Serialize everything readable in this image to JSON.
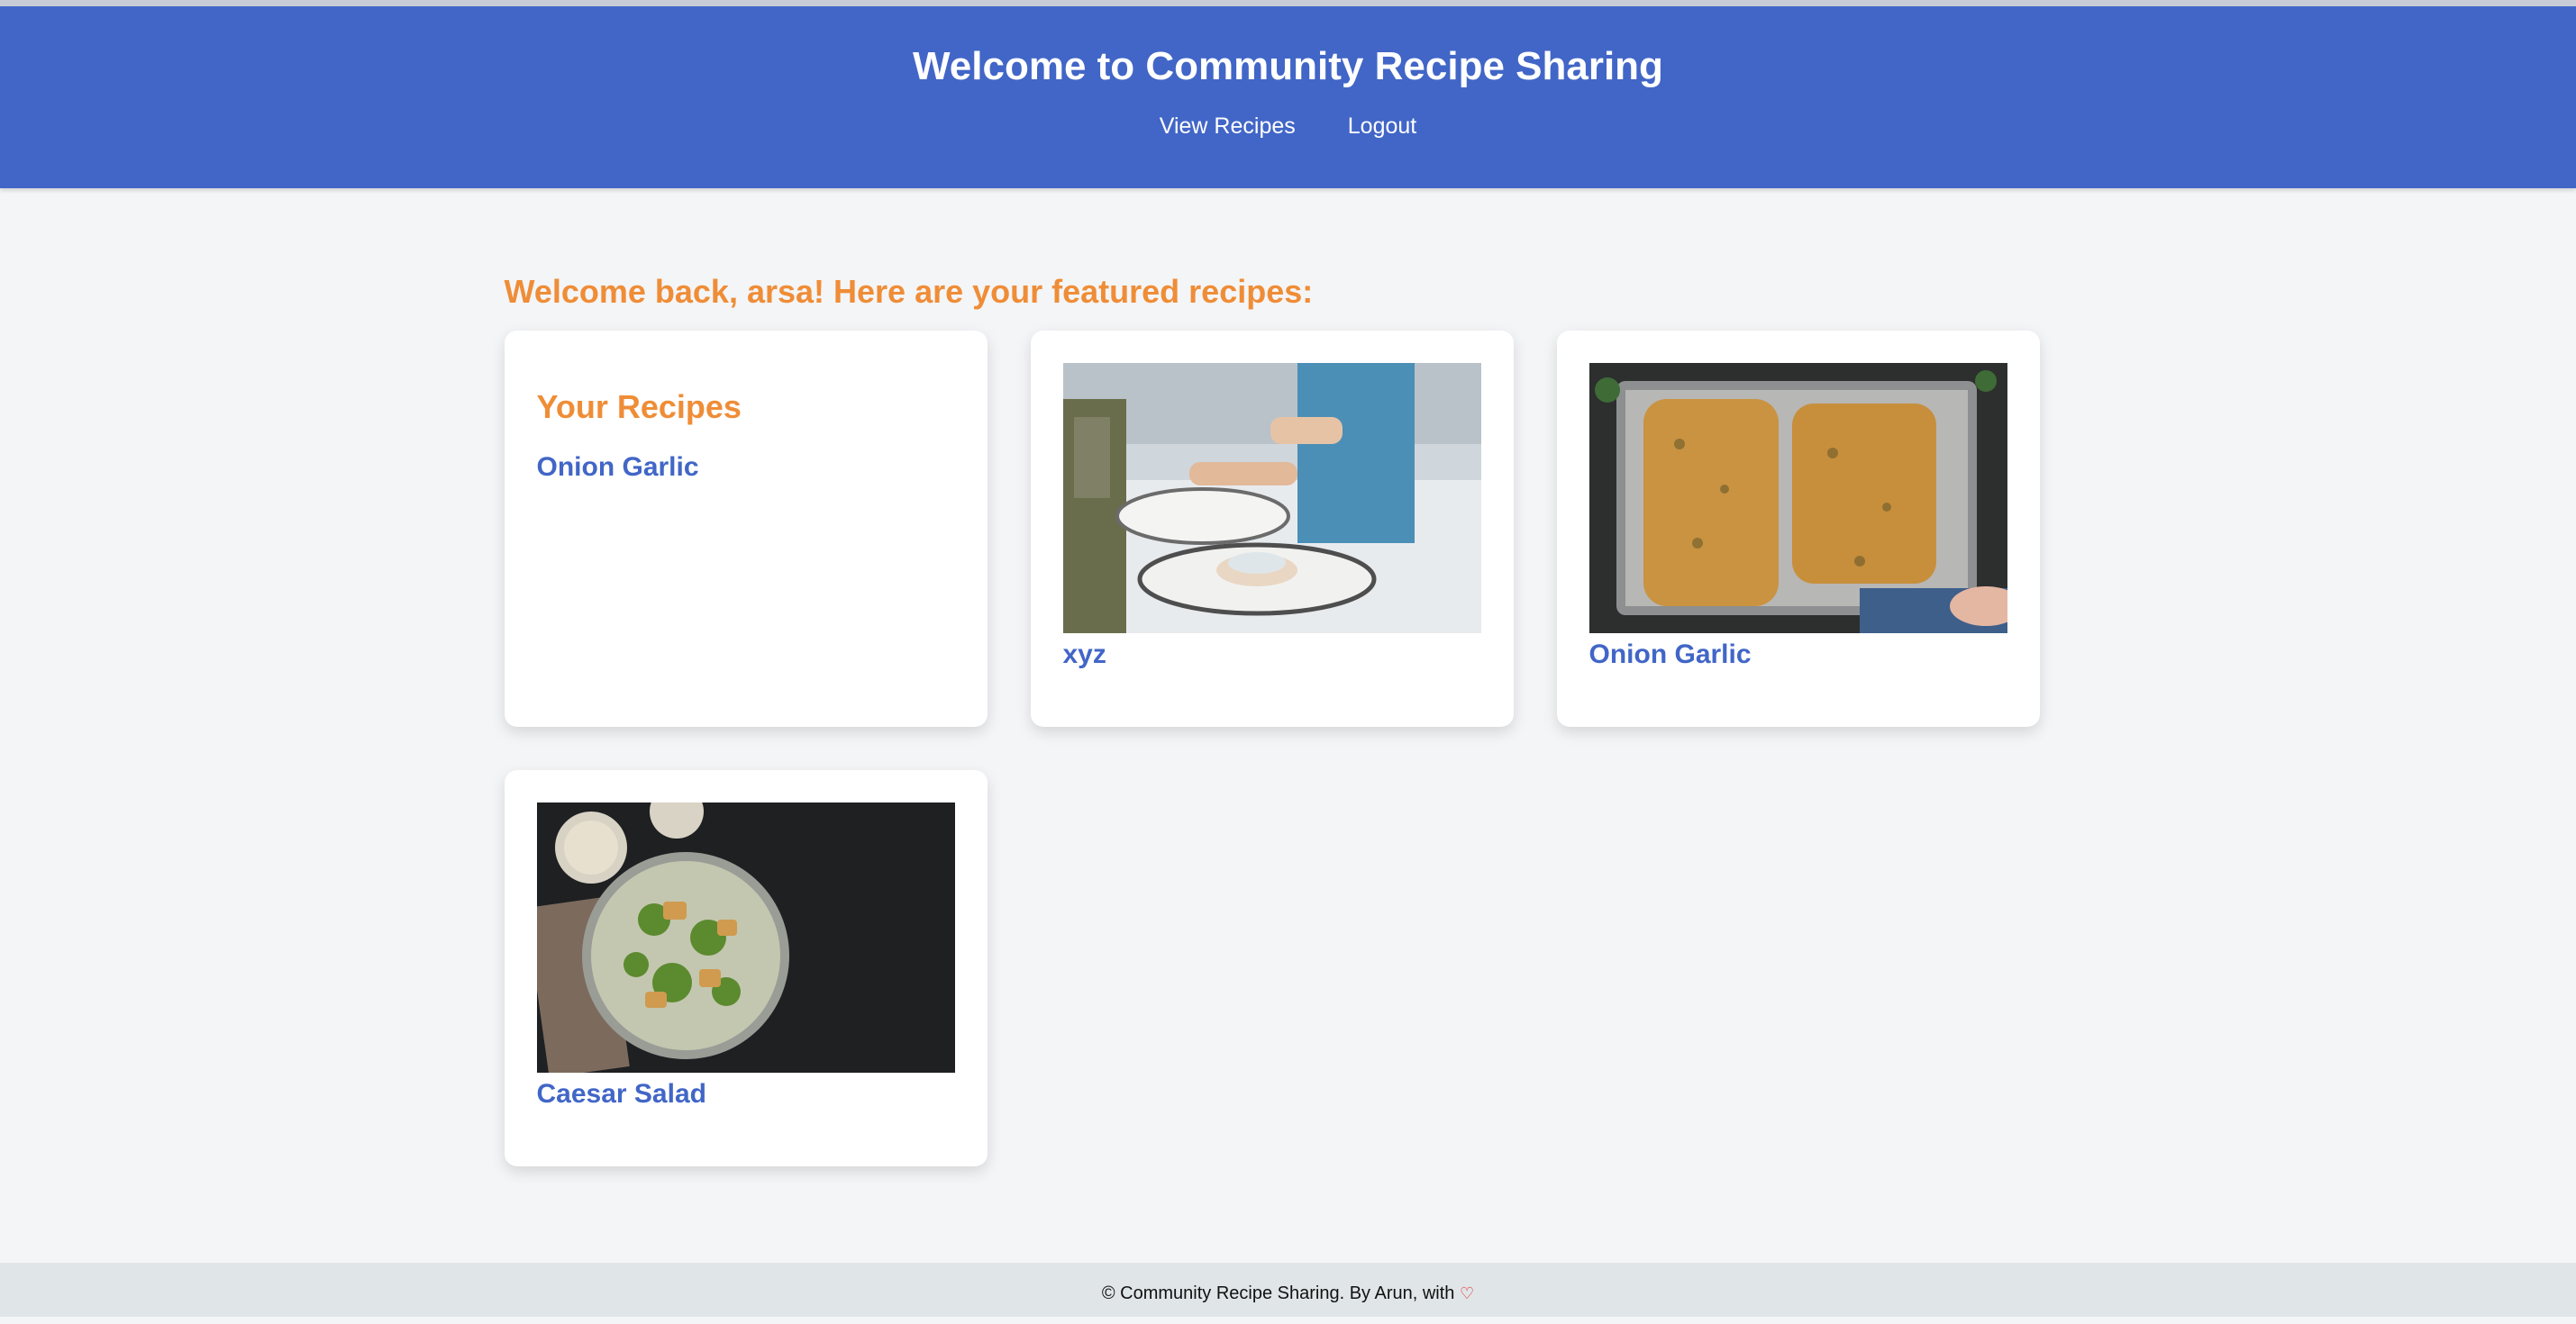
{
  "header": {
    "title": "Welcome to Community Recipe Sharing",
    "nav": [
      {
        "label": "View Recipes"
      },
      {
        "label": "Logout"
      }
    ]
  },
  "main": {
    "welcome": "Welcome back, arsa! Here are your featured recipes:",
    "your_recipes": {
      "heading": "Your Recipes",
      "items": [
        {
          "title": "Onion Garlic"
        }
      ]
    },
    "featured": [
      {
        "title": "xyz",
        "image": "plate-dining-photo"
      },
      {
        "title": "Onion Garlic",
        "image": "garlic-bread-tray-photo"
      },
      {
        "title": "Caesar Salad",
        "image": "caesar-salad-bowl-photo"
      }
    ]
  },
  "footer": {
    "text": "© Community Recipe Sharing. By Arun, with",
    "icon": "heart-icon",
    "heart_color": "#e0201f"
  },
  "colors": {
    "header_bg": "#4166c7",
    "accent_orange": "#ef8d37",
    "link_blue": "#4166c7",
    "page_bg": "#f4f5f7",
    "footer_bg": "#e0e5e8"
  }
}
